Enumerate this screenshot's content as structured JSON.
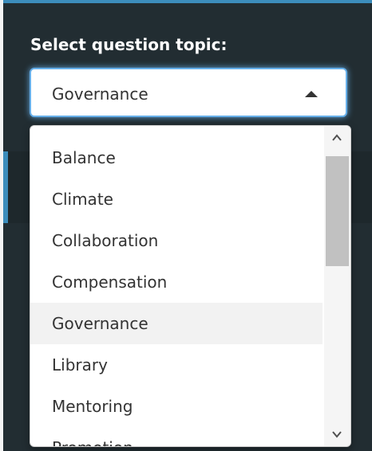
{
  "form": {
    "label": "Select question topic:",
    "selected_value": "Governance"
  },
  "dropdown": {
    "options": [
      "Balance",
      "Climate",
      "Collaboration",
      "Compensation",
      "Governance",
      "Library",
      "Mentoring",
      "Promotion"
    ],
    "highlighted_option": "Governance",
    "scroll_position_fraction": 0
  },
  "colors": {
    "background": "#222d32",
    "focus_border": "#66afe9",
    "highlight_row": "#f2f2f2",
    "accent": "#3c8dbc"
  },
  "icons": {
    "select_caret": "caret-up-icon",
    "scroll_up": "chevron-up-icon",
    "scroll_down": "chevron-down-icon"
  }
}
